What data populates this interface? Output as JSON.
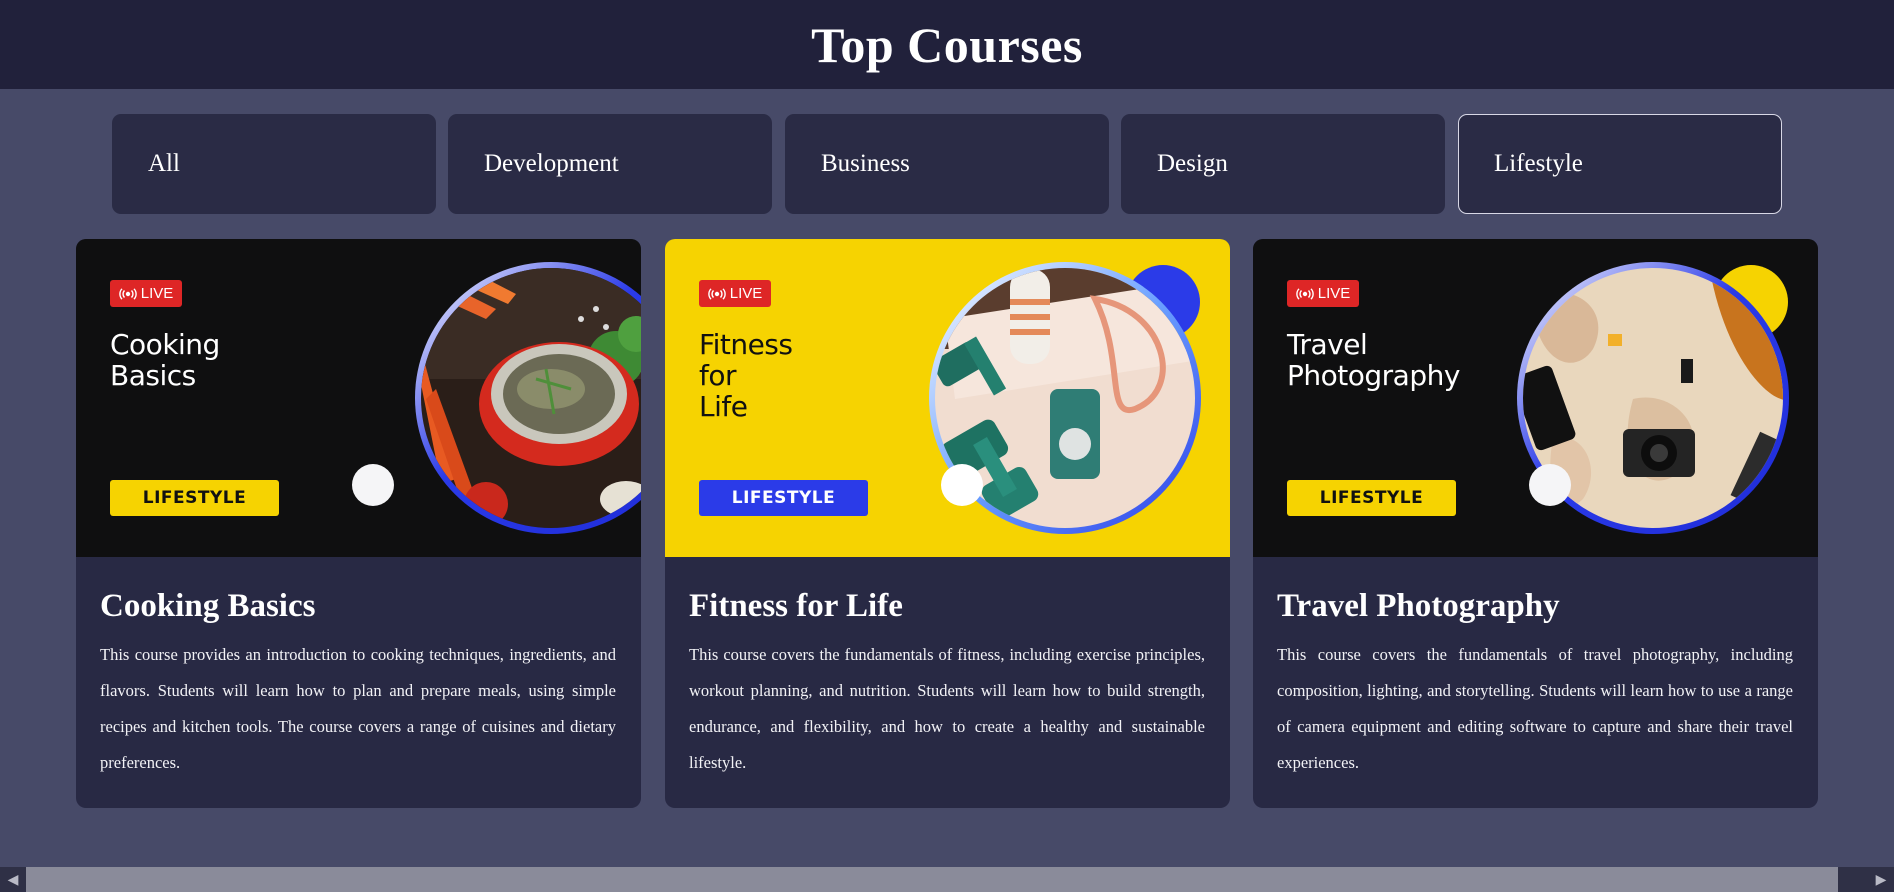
{
  "header": {
    "title": "Top Courses"
  },
  "tabs": [
    {
      "label": "All",
      "active": false
    },
    {
      "label": "Development",
      "active": false
    },
    {
      "label": "Business",
      "active": false
    },
    {
      "label": "Design",
      "active": false
    },
    {
      "label": "Lifestyle",
      "active": true
    }
  ],
  "courses": [
    {
      "title": "Cooking Basics",
      "description": "This course provides an introduction to cooking techniques, ingredients, and flavors. Students will learn how to plan and prepare meals, using simple recipes and kitchen tools. The course covers a range of cuisines and dietary preferences.",
      "banner": {
        "live_label": "LIVE",
        "title_lines": [
          "Cooking",
          "Basics"
        ],
        "category": "LIFESTYLE",
        "theme": "dark",
        "image": "cooking-ingredients-photo"
      }
    },
    {
      "title": "Fitness for Life",
      "description": "This course covers the fundamentals of fitness, including exercise principles, workout planning, and nutrition. Students will learn how to build strength, endurance, and flexibility, and how to create a healthy and sustainable lifestyle.",
      "banner": {
        "live_label": "LIVE",
        "title_lines": [
          "Fitness",
          "for",
          "Life"
        ],
        "category": "LIFESTYLE",
        "theme": "yellow",
        "image": "fitness-equipment-photo"
      }
    },
    {
      "title": "Travel Photography",
      "description": "This course covers the fundamentals of travel photography, including composition, lighting, and storytelling. Students will learn how to use a range of camera equipment and editing software to capture and share their travel experiences.",
      "banner": {
        "live_label": "LIVE",
        "title_lines": [
          "Travel",
          "Photography"
        ],
        "category": "LIFESTYLE",
        "theme": "dark",
        "image": "travel-map-camera-photo"
      }
    }
  ],
  "colors": {
    "page_bg": "#474a68",
    "header_bg": "#21213b",
    "card_bg": "#282944",
    "live_red": "#de2626",
    "accent_yellow": "#f6d301",
    "accent_blue": "#2b3be8"
  },
  "scrollbar": {
    "left_icon": "chevron-left-icon",
    "right_icon": "chevron-right-icon"
  }
}
